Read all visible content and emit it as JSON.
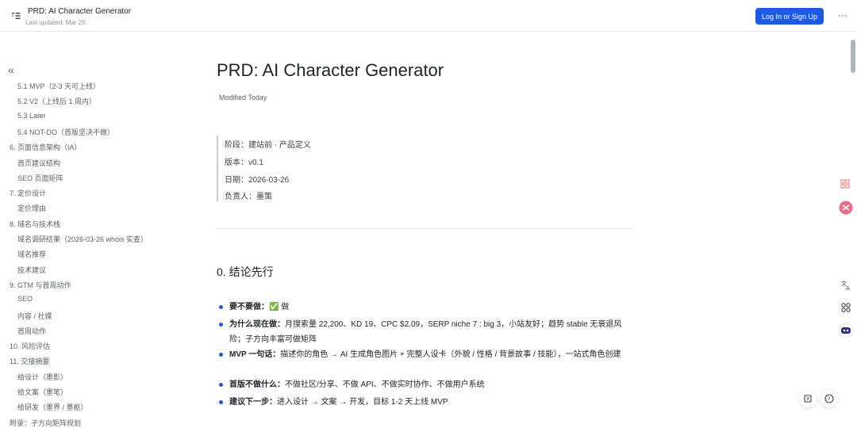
{
  "header": {
    "title": "PRD: AI Character Generator",
    "updated": "Last updated: Mar 26",
    "login_label": "Log In or Sign Up",
    "more_label": "···"
  },
  "toc": {
    "collapse_glyph": "«",
    "items": [
      {
        "label": "5.1 MVP（2-3 天可上线）",
        "indent": 1
      },
      {
        "label": "5.2 V2（上线后 1 周内）",
        "indent": 1
      },
      {
        "label": "5.3 Later",
        "indent": 1
      },
      {
        "label": "5.4 NOT-DO（首版坚决不做）",
        "indent": 1
      },
      {
        "label": "6. 页面信息架构（IA）",
        "indent": 0
      },
      {
        "label": "首页建议结构",
        "indent": 1
      },
      {
        "label": "SEO 页面矩阵",
        "indent": 1
      },
      {
        "label": "7. 定价设计",
        "indent": 0
      },
      {
        "label": "定价理由",
        "indent": 1
      },
      {
        "label": "8. 域名与技术栈",
        "indent": 0
      },
      {
        "label": "域名调研结果（2026-03-26 whois 实查）",
        "indent": 1
      },
      {
        "label": "域名推荐",
        "indent": 1
      },
      {
        "label": "技术建议",
        "indent": 1
      },
      {
        "label": "9. GTM 与首周动作",
        "indent": 0
      },
      {
        "label": "SEO",
        "indent": 1
      },
      {
        "label": "内容 / 社媒",
        "indent": 1
      },
      {
        "label": "首周动作",
        "indent": 1
      },
      {
        "label": "10. 风险评估",
        "indent": 0
      },
      {
        "label": "11. 交接摘要",
        "indent": 0
      },
      {
        "label": "给设计（墨影）",
        "indent": 1
      },
      {
        "label": "给文案（墨笔）",
        "indent": 1
      },
      {
        "label": "给研发（墨界 / 墨枢）",
        "indent": 1
      },
      {
        "label": "附录：子方向矩阵规划",
        "indent": 0
      }
    ]
  },
  "doc": {
    "title": "PRD: AI Character Generator",
    "modified": "Modified Today",
    "meta": [
      "阶段：建站前 · 产品定义",
      "版本：v0.1",
      "日期：2026-03-26",
      "负责人：墨策"
    ],
    "section_heading": "0. 结论先行",
    "bullets": [
      {
        "label": "要不要做：",
        "text": "✅ 做"
      },
      {
        "label": "为什么现在做：",
        "text": "月搜索量 22,200、KD 19、CPC $2.09，SERP niche 7 : big 3，小站友好；趋势 stable 无衰退风险；子方向丰富可做矩阵"
      },
      {
        "label": "MVP 一句话：",
        "text": "描述你的角色 → AI 生成角色图片 + 完整人设卡（外貌 / 性格 / 背景故事 / 技能），一站式角色创建"
      },
      {
        "label": "首版不做什么：",
        "text": "不做社区/分享、不做 API、不做实时协作、不做用户系统"
      },
      {
        "label": "建议下一步：",
        "text": "进入设计 → 文案 → 开发，目标 1-2 天上线 MVP"
      }
    ]
  },
  "colors": {
    "accent": "#1d5ae0",
    "text": "#1f2329",
    "muted": "#8f959e"
  }
}
